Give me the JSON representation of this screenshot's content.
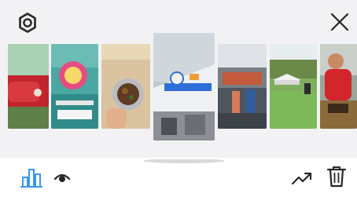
{
  "header": {
    "settings_icon": "gear-icon",
    "close_icon": "close-icon"
  },
  "stories": [
    {
      "label": "story-1",
      "stickers": [
        "",
        ""
      ]
    },
    {
      "label": "story-2",
      "stickers": [
        ""
      ]
    },
    {
      "label": "story-3",
      "stickers": [
        "",
        ""
      ]
    },
    {
      "label": "story-4",
      "stickers": [
        ""
      ]
    },
    {
      "label": "story-5",
      "stickers": [
        "",
        ""
      ]
    },
    {
      "label": "story-6",
      "stickers": [
        ""
      ]
    },
    {
      "label": "story-7",
      "stickers": [
        "",
        ""
      ]
    }
  ],
  "selected_story_index": 3,
  "toolbar": {
    "insights_icon": "bar-chart-icon",
    "viewers_icon": "eye-icon",
    "promote_icon": "trending-up-icon",
    "delete_icon": "trash-icon"
  },
  "colors": {
    "panel_bg": "#f2f2f4",
    "sticker_green": "#5ee36b",
    "accent_blue": "#3897f0",
    "icon_dark": "#262626"
  }
}
